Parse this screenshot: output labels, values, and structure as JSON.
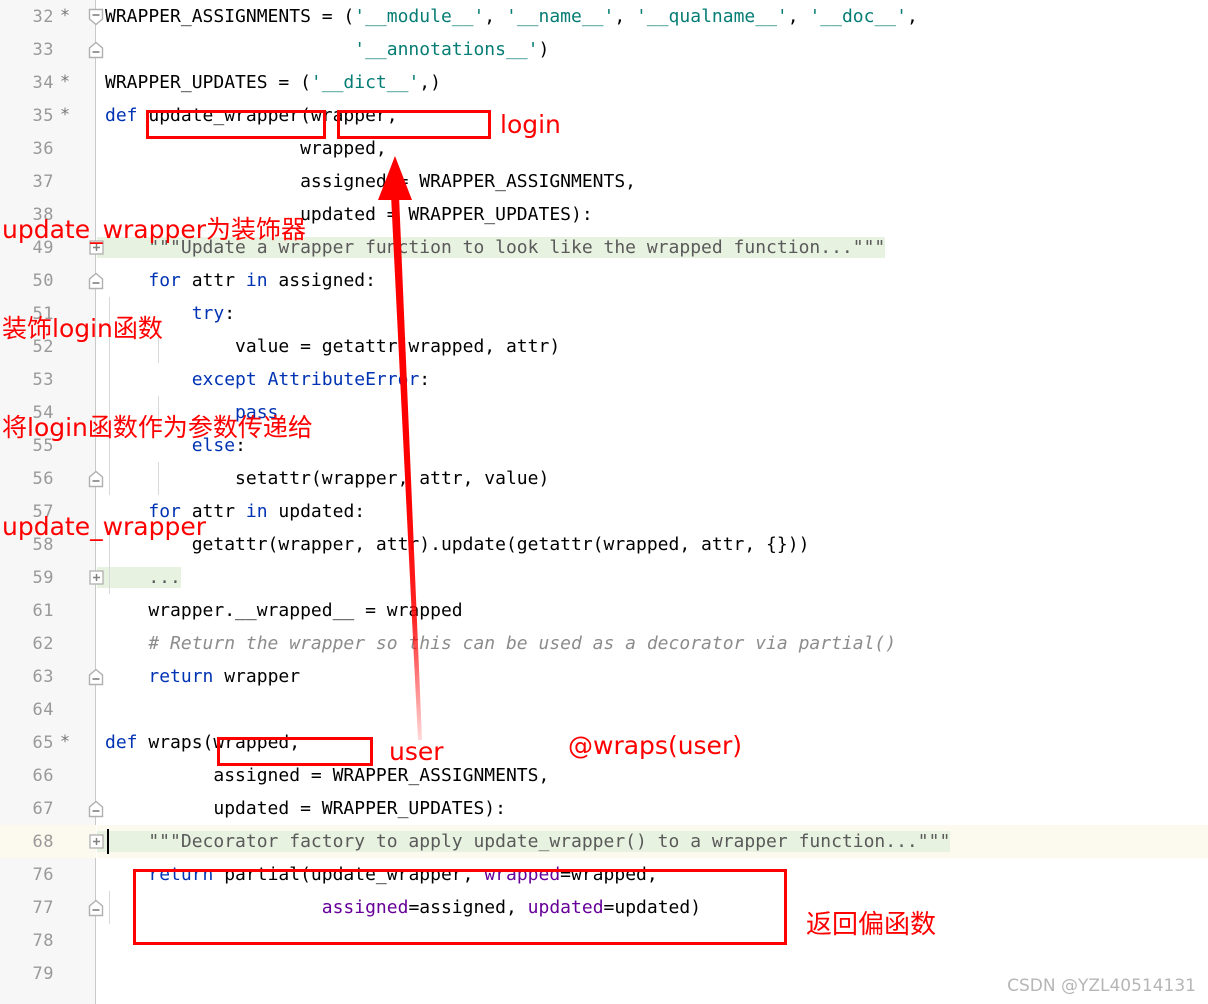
{
  "editor": {
    "font_size_px": 18,
    "line_height_px": 33,
    "background": "#ffffff",
    "gutter_background": "#f7f7f7",
    "current_line_background": "#fcfaef",
    "docstring_background": "#e8f2e0",
    "colors": {
      "keyword": "#0033b3",
      "string": "#067d74",
      "comment": "#8c8c8c",
      "keyword_argument": "#660099",
      "docstring_text": "#5a5a5a",
      "line_number": "#999999",
      "annotation_red": "#ff0000"
    }
  },
  "lines": [
    {
      "num": "32",
      "star": "*",
      "fold": "start",
      "indent_guides": 0,
      "highlight": "none",
      "tokens": [
        {
          "t": "WRAPPER_ASSIGNMENTS = (",
          "c": "plain"
        },
        {
          "t": "'__module__'",
          "c": "str"
        },
        {
          "t": ", ",
          "c": "plain"
        },
        {
          "t": "'__name__'",
          "c": "str"
        },
        {
          "t": ", ",
          "c": "plain"
        },
        {
          "t": "'__qualname__'",
          "c": "str"
        },
        {
          "t": ", ",
          "c": "plain"
        },
        {
          "t": "'__doc__'",
          "c": "str"
        },
        {
          "t": ",",
          "c": "plain"
        }
      ]
    },
    {
      "num": "33",
      "star": "",
      "fold": "end",
      "indent_guides": 0,
      "highlight": "none",
      "tokens": [
        {
          "t": "                       ",
          "c": "plain"
        },
        {
          "t": "'__annotations__'",
          "c": "str"
        },
        {
          "t": ")",
          "c": "plain"
        }
      ]
    },
    {
      "num": "34",
      "star": "*",
      "fold": "none",
      "indent_guides": 0,
      "highlight": "none",
      "tokens": [
        {
          "t": "WRAPPER_UPDATES = (",
          "c": "plain"
        },
        {
          "t": "'__dict__'",
          "c": "str"
        },
        {
          "t": ",)",
          "c": "plain"
        }
      ]
    },
    {
      "num": "35",
      "star": "*",
      "fold": "none",
      "indent_guides": 0,
      "highlight": "none",
      "tokens": [
        {
          "t": "def ",
          "c": "kw"
        },
        {
          "t": "update_wrapper(wrapper,",
          "c": "plain"
        }
      ]
    },
    {
      "num": "36",
      "star": "",
      "fold": "none",
      "indent_guides": 0,
      "highlight": "none",
      "tokens": [
        {
          "t": "                  wrapped,",
          "c": "plain"
        }
      ]
    },
    {
      "num": "37",
      "star": "",
      "fold": "none",
      "indent_guides": 0,
      "highlight": "none",
      "tokens": [
        {
          "t": "                  assigned = WRAPPER_ASSIGNMENTS,",
          "c": "plain"
        }
      ]
    },
    {
      "num": "38",
      "star": "",
      "fold": "none",
      "indent_guides": 0,
      "highlight": "none",
      "tokens": [
        {
          "t": "                  updated = WRAPPER_UPDATES):",
          "c": "plain"
        }
      ]
    },
    {
      "num": "49",
      "star": "",
      "fold": "plus",
      "indent_guides": 0,
      "highlight": "doc",
      "tokens": [
        {
          "t": "    \"\"\"Update a wrapper function to look like the wrapped function...\"\"\"",
          "c": "doc"
        }
      ]
    },
    {
      "num": "50",
      "star": "",
      "fold": "end",
      "indent_guides": 0,
      "highlight": "none",
      "tokens": [
        {
          "t": "    ",
          "c": "plain"
        },
        {
          "t": "for ",
          "c": "kw"
        },
        {
          "t": "attr ",
          "c": "plain"
        },
        {
          "t": "in ",
          "c": "kw"
        },
        {
          "t": "assigned:",
          "c": "plain"
        }
      ]
    },
    {
      "num": "51",
      "star": "",
      "fold": "none",
      "indent_guides": 1,
      "highlight": "none",
      "tokens": [
        {
          "t": "        ",
          "c": "plain"
        },
        {
          "t": "try",
          "c": "kw"
        },
        {
          "t": ":",
          "c": "plain"
        }
      ]
    },
    {
      "num": "52",
      "star": "",
      "fold": "none",
      "indent_guides": 2,
      "highlight": "none",
      "tokens": [
        {
          "t": "            value = getattr(wrapped, attr)",
          "c": "plain"
        }
      ]
    },
    {
      "num": "53",
      "star": "",
      "fold": "none",
      "indent_guides": 1,
      "highlight": "none",
      "tokens": [
        {
          "t": "        ",
          "c": "plain"
        },
        {
          "t": "except ",
          "c": "kw"
        },
        {
          "t": "AttributeError",
          "c": "kw"
        },
        {
          "t": ":",
          "c": "plain"
        }
      ]
    },
    {
      "num": "54",
      "star": "",
      "fold": "none",
      "indent_guides": 2,
      "highlight": "none",
      "tokens": [
        {
          "t": "            ",
          "c": "plain"
        },
        {
          "t": "pass",
          "c": "kw"
        }
      ]
    },
    {
      "num": "55",
      "star": "",
      "fold": "none",
      "indent_guides": 1,
      "highlight": "none",
      "tokens": [
        {
          "t": "        ",
          "c": "plain"
        },
        {
          "t": "else",
          "c": "kw"
        },
        {
          "t": ":",
          "c": "plain"
        }
      ]
    },
    {
      "num": "56",
      "star": "",
      "fold": "end",
      "indent_guides": 2,
      "highlight": "none",
      "tokens": [
        {
          "t": "            setattr(wrapper, attr, value)",
          "c": "plain"
        }
      ]
    },
    {
      "num": "57",
      "star": "",
      "fold": "none",
      "indent_guides": 0,
      "highlight": "none",
      "tokens": [
        {
          "t": "    ",
          "c": "plain"
        },
        {
          "t": "for ",
          "c": "kw"
        },
        {
          "t": "attr ",
          "c": "plain"
        },
        {
          "t": "in ",
          "c": "kw"
        },
        {
          "t": "updated:",
          "c": "plain"
        }
      ]
    },
    {
      "num": "58",
      "star": "",
      "fold": "none",
      "indent_guides": 1,
      "highlight": "none",
      "tokens": [
        {
          "t": "        getattr(wrapper, attr).update(getattr(wrapped, attr, {}))",
          "c": "plain"
        }
      ]
    },
    {
      "num": "59",
      "star": "",
      "fold": "plus",
      "indent_guides": 1,
      "highlight": "fold",
      "tokens": [
        {
          "t": "    ...",
          "c": "doc"
        }
      ]
    },
    {
      "num": "61",
      "star": "",
      "fold": "none",
      "indent_guides": 0,
      "highlight": "none",
      "tokens": [
        {
          "t": "    wrapper.__wrapped__ = wrapped",
          "c": "plain"
        }
      ]
    },
    {
      "num": "62",
      "star": "",
      "fold": "none",
      "indent_guides": 0,
      "highlight": "none",
      "tokens": [
        {
          "t": "    # Return the wrapper so this can be used as a decorator via partial()",
          "c": "cmt"
        }
      ]
    },
    {
      "num": "63",
      "star": "",
      "fold": "end",
      "indent_guides": 0,
      "highlight": "none",
      "tokens": [
        {
          "t": "    ",
          "c": "plain"
        },
        {
          "t": "return ",
          "c": "kw"
        },
        {
          "t": "wrapper",
          "c": "plain"
        }
      ]
    },
    {
      "num": "64",
      "star": "",
      "fold": "none",
      "indent_guides": 0,
      "highlight": "none",
      "tokens": [
        {
          "t": "",
          "c": "plain"
        }
      ]
    },
    {
      "num": "65",
      "star": "*",
      "fold": "none",
      "indent_guides": 0,
      "highlight": "none",
      "tokens": [
        {
          "t": "def ",
          "c": "kw"
        },
        {
          "t": "wraps(wrapped,",
          "c": "plain"
        }
      ]
    },
    {
      "num": "66",
      "star": "",
      "fold": "none",
      "indent_guides": 0,
      "highlight": "none",
      "tokens": [
        {
          "t": "          assigned = WRAPPER_ASSIGNMENTS,",
          "c": "plain"
        }
      ]
    },
    {
      "num": "67",
      "star": "",
      "fold": "end",
      "indent_guides": 0,
      "highlight": "none",
      "tokens": [
        {
          "t": "          updated = WRAPPER_UPDATES):",
          "c": "plain"
        }
      ]
    },
    {
      "num": "68",
      "star": "",
      "fold": "plus",
      "indent_guides": 0,
      "highlight": "current-doc",
      "tokens": [
        {
          "t": "    \"\"\"Decorator factory to apply update_wrapper() to a wrapper function...\"\"\"",
          "c": "doc"
        }
      ]
    },
    {
      "num": "76",
      "star": "",
      "fold": "none",
      "indent_guides": 0,
      "highlight": "none",
      "tokens": [
        {
          "t": "    ",
          "c": "plain"
        },
        {
          "t": "return ",
          "c": "kw"
        },
        {
          "t": "partial(update_wrapper, ",
          "c": "plain"
        },
        {
          "t": "wrapped",
          "c": "kwarg"
        },
        {
          "t": "=wrapped,",
          "c": "plain"
        }
      ]
    },
    {
      "num": "77",
      "star": "",
      "fold": "end",
      "indent_guides": 1,
      "highlight": "none",
      "tokens": [
        {
          "t": "                    ",
          "c": "plain"
        },
        {
          "t": "assigned",
          "c": "kwarg"
        },
        {
          "t": "=assigned, ",
          "c": "plain"
        },
        {
          "t": "updated",
          "c": "kwarg"
        },
        {
          "t": "=updated)",
          "c": "plain"
        }
      ]
    },
    {
      "num": "78",
      "star": "",
      "fold": "none",
      "indent_guides": 0,
      "highlight": "none",
      "tokens": [
        {
          "t": "",
          "c": "plain"
        }
      ]
    },
    {
      "num": "79",
      "star": "",
      "fold": "none",
      "indent_guides": 0,
      "highlight": "none",
      "tokens": [
        {
          "t": "",
          "c": "plain"
        }
      ]
    }
  ],
  "annotations": {
    "label_login": "login",
    "label_user": "user",
    "label_wraps_user": "@wraps(user)",
    "label_return_partial": "返回偏函数",
    "chinese_note_lines": [
      "update_wrapper为装饰器",
      "装饰login函数",
      "将login函数作为参数传递给",
      "update_wrapper"
    ],
    "boxes": [
      {
        "name": "box-update-wrapper-name"
      },
      {
        "name": "box-wrapper-param"
      },
      {
        "name": "box-wraps-wrapped-param"
      },
      {
        "name": "box-return-partial"
      }
    ],
    "arrow": {
      "name": "arrow-up-to-wrapped"
    }
  },
  "watermark": "CSDN @YZL40514131"
}
